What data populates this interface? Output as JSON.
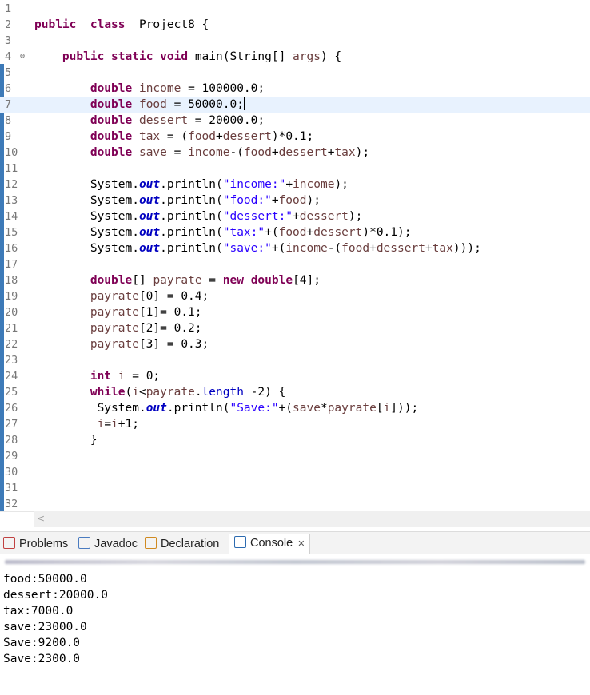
{
  "editor": {
    "lines": [
      {
        "n": "1",
        "t": []
      },
      {
        "n": "2",
        "t": [
          [
            "kw",
            "public"
          ],
          [
            "",
            "  "
          ],
          [
            "kw",
            "class"
          ],
          [
            "",
            "  Project8 {"
          ]
        ]
      },
      {
        "n": "3",
        "t": []
      },
      {
        "n": "4",
        "t": [
          [
            "",
            "    "
          ],
          [
            "kw",
            "public"
          ],
          [
            "",
            " "
          ],
          [
            "kw",
            "static"
          ],
          [
            "",
            " "
          ],
          [
            "kw",
            "void"
          ],
          [
            "",
            " main(String[] "
          ],
          [
            "var",
            "args"
          ],
          [
            "",
            ") {"
          ]
        ]
      },
      {
        "n": "5",
        "t": []
      },
      {
        "n": "6",
        "t": [
          [
            "",
            "        "
          ],
          [
            "kw",
            "double"
          ],
          [
            "",
            " "
          ],
          [
            "var",
            "income"
          ],
          [
            "",
            " = 100000.0;"
          ]
        ]
      },
      {
        "n": "7",
        "t": [
          [
            "",
            "        "
          ],
          [
            "kw",
            "double"
          ],
          [
            "",
            " "
          ],
          [
            "var",
            "food"
          ],
          [
            "",
            " = 50000.0;"
          ]
        ]
      },
      {
        "n": "8",
        "t": [
          [
            "",
            "        "
          ],
          [
            "kw",
            "double"
          ],
          [
            "",
            " "
          ],
          [
            "var",
            "dessert"
          ],
          [
            "",
            " = 20000.0;"
          ]
        ]
      },
      {
        "n": "9",
        "t": [
          [
            "",
            "        "
          ],
          [
            "kw",
            "double"
          ],
          [
            "",
            " "
          ],
          [
            "var",
            "tax"
          ],
          [
            "",
            " = ("
          ],
          [
            "var",
            "food"
          ],
          [
            "",
            "+"
          ],
          [
            "var",
            "dessert"
          ],
          [
            "",
            ")*0.1;"
          ]
        ]
      },
      {
        "n": "10",
        "t": [
          [
            "",
            "        "
          ],
          [
            "kw",
            "double"
          ],
          [
            "",
            " "
          ],
          [
            "var",
            "save"
          ],
          [
            "",
            " = "
          ],
          [
            "var",
            "income"
          ],
          [
            "",
            "-("
          ],
          [
            "var",
            "food"
          ],
          [
            "",
            "+"
          ],
          [
            "var",
            "dessert"
          ],
          [
            "",
            "+"
          ],
          [
            "var",
            "tax"
          ],
          [
            "",
            ");"
          ]
        ]
      },
      {
        "n": "11",
        "t": []
      },
      {
        "n": "12",
        "t": [
          [
            "",
            "        System."
          ],
          [
            "field",
            "out"
          ],
          [
            "",
            ".println("
          ],
          [
            "str",
            "\"income:\""
          ],
          [
            "",
            "+"
          ],
          [
            "var",
            "income"
          ],
          [
            "",
            ");"
          ]
        ]
      },
      {
        "n": "13",
        "t": [
          [
            "",
            "        System."
          ],
          [
            "field",
            "out"
          ],
          [
            "",
            ".println("
          ],
          [
            "str",
            "\"food:\""
          ],
          [
            "",
            "+"
          ],
          [
            "var",
            "food"
          ],
          [
            "",
            ");"
          ]
        ]
      },
      {
        "n": "14",
        "t": [
          [
            "",
            "        System."
          ],
          [
            "field",
            "out"
          ],
          [
            "",
            ".println("
          ],
          [
            "str",
            "\"dessert:\""
          ],
          [
            "",
            "+"
          ],
          [
            "var",
            "dessert"
          ],
          [
            "",
            ");"
          ]
        ]
      },
      {
        "n": "15",
        "t": [
          [
            "",
            "        System."
          ],
          [
            "field",
            "out"
          ],
          [
            "",
            ".println("
          ],
          [
            "str",
            "\"tax:\""
          ],
          [
            "",
            "+("
          ],
          [
            "var",
            "food"
          ],
          [
            "",
            "+"
          ],
          [
            "var",
            "dessert"
          ],
          [
            "",
            ")*0.1);"
          ]
        ]
      },
      {
        "n": "16",
        "t": [
          [
            "",
            "        System."
          ],
          [
            "field",
            "out"
          ],
          [
            "",
            ".println("
          ],
          [
            "str",
            "\"save:\""
          ],
          [
            "",
            "+("
          ],
          [
            "var",
            "income"
          ],
          [
            "",
            "-("
          ],
          [
            "var",
            "food"
          ],
          [
            "",
            "+"
          ],
          [
            "var",
            "dessert"
          ],
          [
            "",
            "+"
          ],
          [
            "var",
            "tax"
          ],
          [
            "",
            ")));"
          ]
        ]
      },
      {
        "n": "17",
        "t": []
      },
      {
        "n": "18",
        "t": [
          [
            "",
            "        "
          ],
          [
            "kw",
            "double"
          ],
          [
            "",
            "[] "
          ],
          [
            "var",
            "payrate"
          ],
          [
            "",
            " = "
          ],
          [
            "kw",
            "new"
          ],
          [
            "",
            " "
          ],
          [
            "kw",
            "double"
          ],
          [
            "",
            "[4];"
          ]
        ]
      },
      {
        "n": "19",
        "t": [
          [
            "",
            "        "
          ],
          [
            "var",
            "payrate"
          ],
          [
            "",
            "[0] = 0.4;"
          ]
        ]
      },
      {
        "n": "20",
        "t": [
          [
            "",
            "        "
          ],
          [
            "var",
            "payrate"
          ],
          [
            "",
            "[1]= 0.1;"
          ]
        ]
      },
      {
        "n": "21",
        "t": [
          [
            "",
            "        "
          ],
          [
            "var",
            "payrate"
          ],
          [
            "",
            "[2]= 0.2;"
          ]
        ]
      },
      {
        "n": "22",
        "t": [
          [
            "",
            "        "
          ],
          [
            "var",
            "payrate"
          ],
          [
            "",
            "[3] = 0.3;"
          ]
        ]
      },
      {
        "n": "23",
        "t": []
      },
      {
        "n": "24",
        "t": [
          [
            "",
            "        "
          ],
          [
            "kw",
            "int"
          ],
          [
            "",
            " "
          ],
          [
            "var",
            "i"
          ],
          [
            "",
            " = 0;"
          ]
        ]
      },
      {
        "n": "25",
        "t": [
          [
            "",
            "        "
          ],
          [
            "kw",
            "while"
          ],
          [
            "",
            "("
          ],
          [
            "var",
            "i"
          ],
          [
            "",
            "<"
          ],
          [
            "var",
            "payrate"
          ],
          [
            "",
            "."
          ],
          [
            "field2",
            "length"
          ],
          [
            "",
            " -2) {"
          ]
        ]
      },
      {
        "n": "26",
        "t": [
          [
            "",
            "         System."
          ],
          [
            "field",
            "out"
          ],
          [
            "",
            ".println("
          ],
          [
            "str",
            "\"Save:\""
          ],
          [
            "",
            "+("
          ],
          [
            "var",
            "save"
          ],
          [
            "",
            "*"
          ],
          [
            "var",
            "payrate"
          ],
          [
            "",
            "["
          ],
          [
            "var",
            "i"
          ],
          [
            "",
            "]));"
          ]
        ]
      },
      {
        "n": "27",
        "t": [
          [
            "",
            "         "
          ],
          [
            "var",
            "i"
          ],
          [
            "",
            "="
          ],
          [
            "var",
            "i"
          ],
          [
            "",
            "+1;"
          ]
        ]
      },
      {
        "n": "28",
        "t": [
          [
            "",
            "        }"
          ]
        ]
      },
      {
        "n": "29",
        "t": []
      },
      {
        "n": "30",
        "t": []
      },
      {
        "n": "31",
        "t": []
      },
      {
        "n": "32",
        "t": []
      }
    ],
    "current_line": 7,
    "fold_line": 4
  },
  "tabs": [
    {
      "label": "Problems",
      "icon": "problems-icon",
      "color": "#c04040"
    },
    {
      "label": "Javadoc",
      "icon": "javadoc-icon",
      "color": "#4a7bc0"
    },
    {
      "label": "Declaration",
      "icon": "declaration-icon",
      "color": "#d08a20"
    },
    {
      "label": "Console",
      "icon": "console-icon",
      "color": "#2d6bb0",
      "active": true
    }
  ],
  "console": {
    "lines": [
      "food:50000.0",
      "dessert:20000.0",
      "tax:7000.0",
      "save:23000.0",
      "Save:9200.0",
      "Save:2300.0"
    ]
  }
}
